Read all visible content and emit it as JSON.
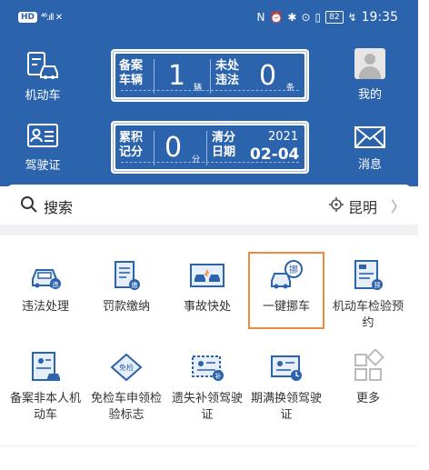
{
  "status_bar": {
    "hd_badge": "HD",
    "signal": "⁴⁶.ıll ✕",
    "battery": "82",
    "time": "19:35"
  },
  "header": {
    "left_items": [
      {
        "label": "机动车",
        "icon": "car-icon"
      },
      {
        "label": "驾驶证",
        "icon": "license-icon"
      }
    ],
    "right_items": [
      {
        "label": "我的",
        "icon": "avatar-icon"
      },
      {
        "label": "消息",
        "icon": "mail-icon"
      }
    ],
    "vehicle_card": {
      "left_label": "备案车辆",
      "left_value": "1",
      "left_unit": "辆",
      "right_label": "未处违法",
      "right_value": "0",
      "right_unit": "条"
    },
    "license_card": {
      "left_label": "累积记分",
      "left_value": "0",
      "left_unit": "分",
      "right_label": "清分日期",
      "year": "2021",
      "month_day": "02-04"
    }
  },
  "search": {
    "label": "搜索",
    "city": "昆明",
    "chevron": "〉"
  },
  "services": [
    {
      "label": "违法处理",
      "icon": "violation-car-icon"
    },
    {
      "label": "罚款缴纳",
      "icon": "fine-payment-icon"
    },
    {
      "label": "事故快处",
      "icon": "accident-icon"
    },
    {
      "label": "一键挪车",
      "icon": "move-car-icon",
      "highlighted": true
    },
    {
      "label": "机动车检验预约",
      "icon": "inspection-appointment-icon"
    },
    {
      "label": "备案非本人机动车",
      "icon": "register-vehicle-icon"
    },
    {
      "label": "免检车申领检验标志",
      "icon": "exempt-sticker-icon",
      "badge": "免检"
    },
    {
      "label": "遗失补领驾驶证",
      "icon": "lost-license-icon"
    },
    {
      "label": "期满换领驾驶证",
      "icon": "renew-license-icon"
    },
    {
      "label": "更多",
      "icon": "more-grid-icon"
    }
  ],
  "colors": {
    "header_blue": "#2c63ad",
    "highlight_orange": "#f08a3c",
    "icon_blue": "#2c63ad"
  }
}
